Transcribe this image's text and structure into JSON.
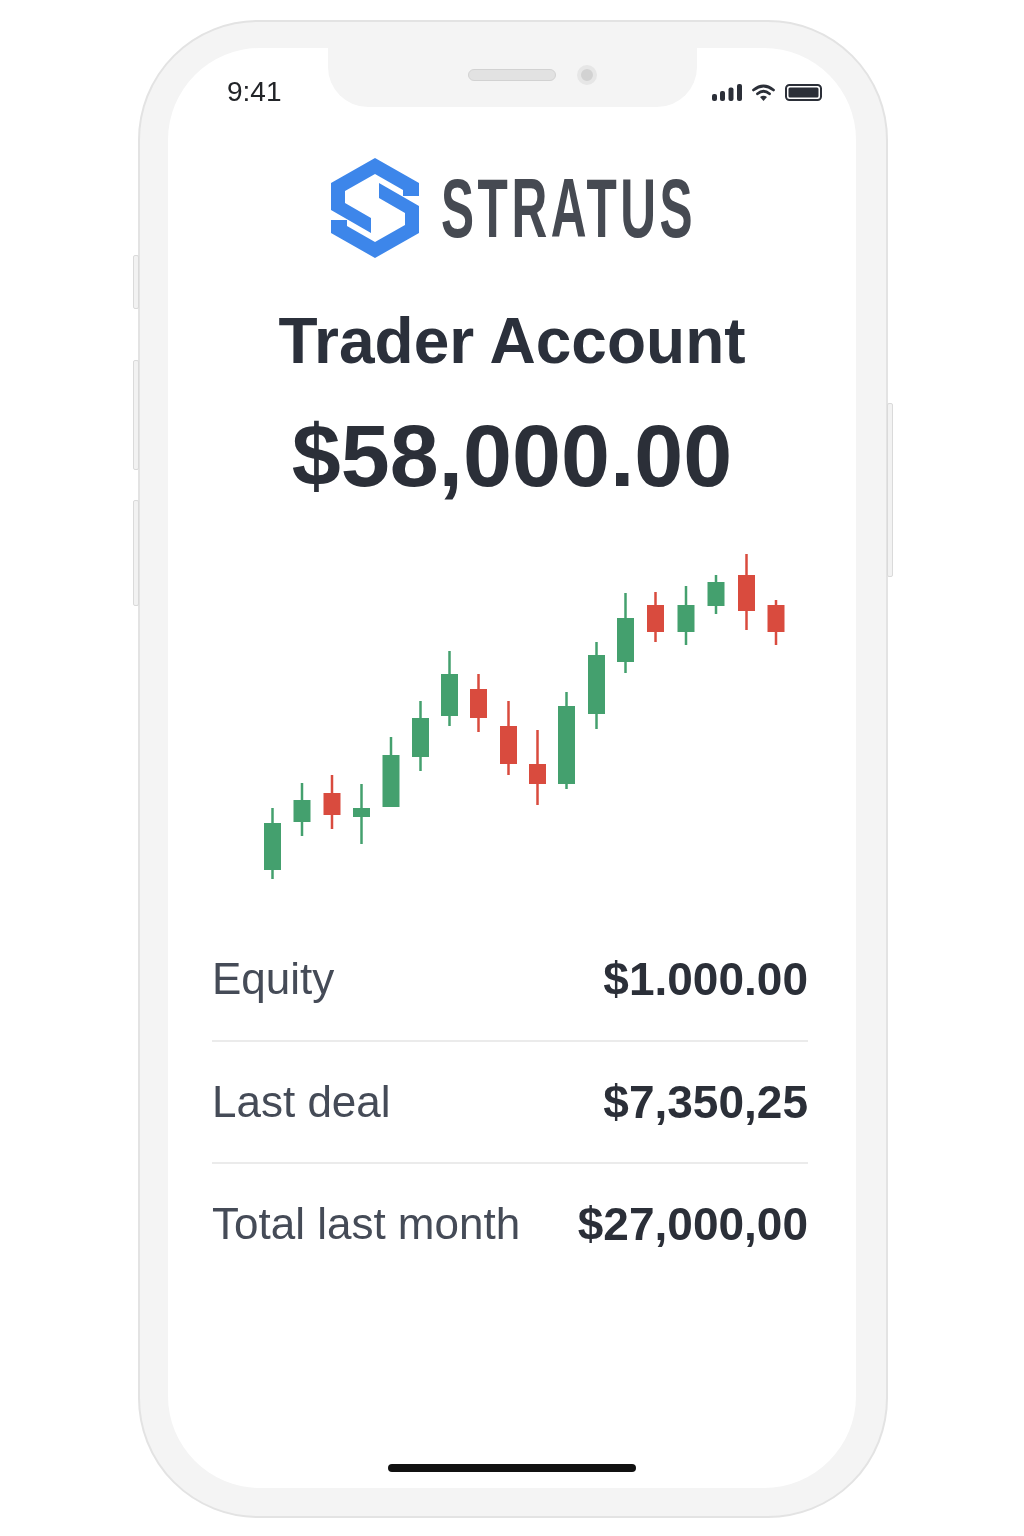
{
  "status_bar": {
    "time": "9:41"
  },
  "brand": {
    "name": "STRATUS"
  },
  "account": {
    "title": "Trader Account",
    "balance": "$58,000.00"
  },
  "stats": [
    {
      "label": "Equity",
      "value": "$1.000.00"
    },
    {
      "label": "Last deal",
      "value": "$7,350,25"
    },
    {
      "label": "Total last month",
      "value": "$27,000,00"
    }
  ]
}
